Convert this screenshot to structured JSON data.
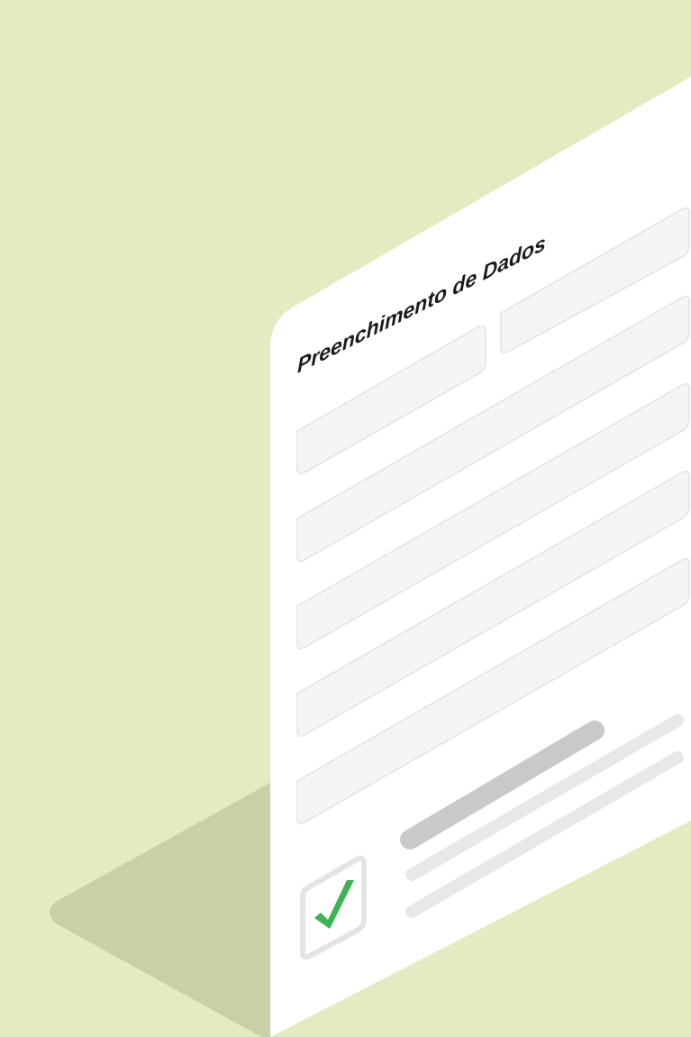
{
  "colors": {
    "background": "#E3EBC2",
    "shadow": "#C8D0A8",
    "card": "#FFFFFF",
    "field_fill": "#F4F5F6",
    "field_border": "#E1E3E4",
    "bar_dark": "#C9C9C9",
    "bar_light": "#E8E8E8",
    "check_green": "#3DB356",
    "checkbox_border": "#E4E4E4"
  },
  "form": {
    "title": "Preenchimento de Dados",
    "checkbox": {
      "checked": true,
      "icon": "checkmark-icon"
    }
  }
}
